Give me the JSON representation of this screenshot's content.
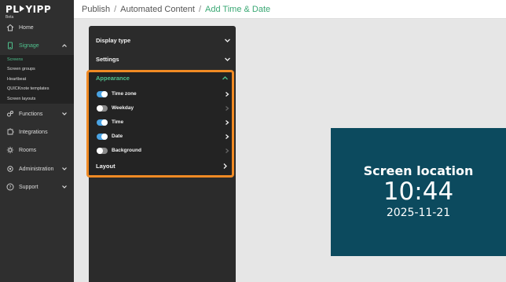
{
  "brand": {
    "logo_pre": "PL",
    "logo_post": "YIPP",
    "badge": "Beta"
  },
  "nav": {
    "home": "Home",
    "signage": "Signage",
    "functions": "Functions",
    "integrations": "Integrations",
    "rooms": "Rooms",
    "administration": "Administration",
    "support": "Support"
  },
  "subnav": [
    "Screens",
    "Screen groups",
    "Heartbeat",
    "QUICKnote templates",
    "Screen layouts"
  ],
  "breadcrumb": {
    "a": "Publish",
    "b": "Automated Content",
    "c": "Add Time & Date",
    "sep": "/"
  },
  "panel": {
    "display_type": "Display type",
    "settings": "Settings",
    "appearance": "Appearance",
    "layout": "Layout",
    "toggles": [
      {
        "label": "Time zone",
        "on": true
      },
      {
        "label": "Weekday",
        "on": false
      },
      {
        "label": "Time",
        "on": true
      },
      {
        "label": "Date",
        "on": true
      },
      {
        "label": "Background",
        "on": false
      }
    ]
  },
  "preview": {
    "location": "Screen location",
    "time": "10:44",
    "date": "2025-11-21"
  },
  "colors": {
    "accent": "#4fc18d",
    "highlight": "#f08a24",
    "toggle_on": "#4aa3e3",
    "preview_bg": "#0c4a5e"
  }
}
